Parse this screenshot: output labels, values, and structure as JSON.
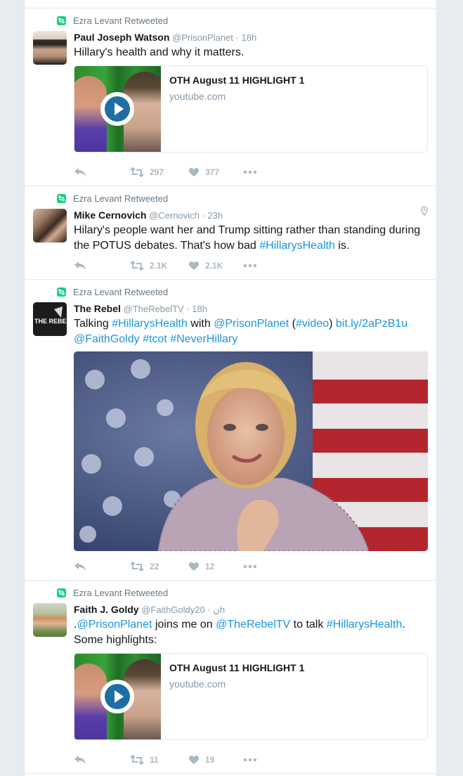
{
  "tweets": [
    {
      "retweet_label": "Ezra Levant Retweeted",
      "name": "Paul Joseph Watson",
      "handle": "@PrisonPlanet",
      "time": "18h",
      "text": "Hillary's health and why it matters.",
      "card": {
        "title": "OTH August 11 HIGHLIGHT 1",
        "domain": "youtube.com"
      },
      "retweets": "297",
      "likes": "377"
    },
    {
      "retweet_label": "Ezra Levant Retweeted",
      "name": "Mike Cernovich",
      "handle": "@Cernovich",
      "time": "23h",
      "text_parts": [
        "Hilary's people want her and Trump sitting rather than standing during the POTUS debates. That's how bad ",
        "#HillarysHealth",
        " is."
      ],
      "retweets": "2.1K",
      "likes": "2.1K"
    },
    {
      "retweet_label": "Ezra Levant Retweeted",
      "name": "The Rebel",
      "handle": "@TheRebelTV",
      "time": "18h",
      "text_parts": [
        "Talking ",
        "#HillarysHealth",
        " with ",
        "@PrisonPlanet",
        " (",
        "#video",
        ") ",
        "bit.ly/2aPzB1u",
        " ",
        "@FaithGoldy",
        " ",
        "#tcot",
        " ",
        "#NeverHillary"
      ],
      "retweets": "22",
      "likes": "12",
      "avatar_text": "THE REBEL"
    },
    {
      "retweet_label": "Ezra Levant Retweeted",
      "name": "Faith J. Goldy",
      "handle": "@FaithGoldy",
      "handle_suffix": "ن",
      "time": "20h",
      "text_parts": [
        ".",
        "@PrisonPlanet",
        " joins me on ",
        "@TheRebelTV",
        " to talk ",
        "#HillarysHealth",
        ". Some highlights:"
      ],
      "card": {
        "title": "OTH August 11 HIGHLIGHT 1",
        "domain": "youtube.com"
      },
      "retweets": "11",
      "likes": "19"
    }
  ],
  "colors": {
    "link": "#1b95e0",
    "retweet_green": "#19cf86",
    "muted": "#8899a6",
    "action_gray": "#aab8c2"
  }
}
